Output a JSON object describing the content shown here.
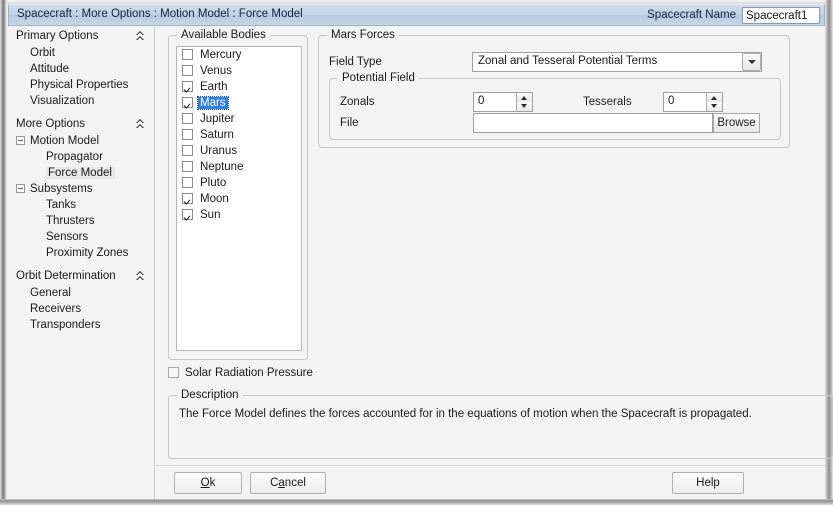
{
  "window": {
    "title": "Spacecraft : More Options : Motion Model : Force Model",
    "spacecraft_name_label": "Spacecraft Name",
    "spacecraft_name_value": "Spacecraft1",
    "accent_selection_color": "#2f7fe0",
    "titlebar_color": "#c2d2e6"
  },
  "tree": {
    "sections": [
      {
        "label": "Primary Options",
        "collapse_icon": "double-chevron-up-icon",
        "items": [
          {
            "label": "Orbit",
            "level": 1,
            "selected": false,
            "expander": false
          },
          {
            "label": "Attitude",
            "level": 1,
            "selected": false,
            "expander": false
          },
          {
            "label": "Physical Properties",
            "level": 1,
            "selected": false,
            "expander": false
          },
          {
            "label": "Visualization",
            "level": 1,
            "selected": false,
            "expander": false
          }
        ]
      },
      {
        "label": "More Options",
        "collapse_icon": "double-chevron-up-icon",
        "items": [
          {
            "label": "Motion Model",
            "level": 2,
            "selected": false,
            "expander": true
          },
          {
            "label": "Propagator",
            "level": 3,
            "selected": false,
            "expander": false
          },
          {
            "label": "Force Model",
            "level": 3,
            "selected": true,
            "expander": false
          },
          {
            "label": "Subsystems",
            "level": 2,
            "selected": false,
            "expander": true
          },
          {
            "label": "Tanks",
            "level": 3,
            "selected": false,
            "expander": false
          },
          {
            "label": "Thrusters",
            "level": 3,
            "selected": false,
            "expander": false
          },
          {
            "label": "Sensors",
            "level": 3,
            "selected": false,
            "expander": false
          },
          {
            "label": "Proximity Zones",
            "level": 3,
            "selected": false,
            "expander": false
          }
        ]
      },
      {
        "label": "Orbit Determination",
        "collapse_icon": "double-chevron-up-icon",
        "items": [
          {
            "label": "General",
            "level": 1,
            "selected": false,
            "expander": false
          },
          {
            "label": "Receivers",
            "level": 1,
            "selected": false,
            "expander": false
          },
          {
            "label": "Transponders",
            "level": 1,
            "selected": false,
            "expander": false
          }
        ]
      }
    ]
  },
  "available_bodies": {
    "group_title": "Available Bodies",
    "items": [
      {
        "label": "Mercury",
        "checked": false,
        "selected": false
      },
      {
        "label": "Venus",
        "checked": false,
        "selected": false
      },
      {
        "label": "Earth",
        "checked": true,
        "selected": false
      },
      {
        "label": "Mars",
        "checked": true,
        "selected": true
      },
      {
        "label": "Jupiter",
        "checked": false,
        "selected": false
      },
      {
        "label": "Saturn",
        "checked": false,
        "selected": false
      },
      {
        "label": "Uranus",
        "checked": false,
        "selected": false
      },
      {
        "label": "Neptune",
        "checked": false,
        "selected": false
      },
      {
        "label": "Pluto",
        "checked": false,
        "selected": false
      },
      {
        "label": "Moon",
        "checked": true,
        "selected": false
      },
      {
        "label": "Sun",
        "checked": true,
        "selected": false
      }
    ]
  },
  "solar_radiation_pressure": {
    "label": "Solar Radiation Pressure",
    "checked": false
  },
  "mars_forces": {
    "group_title": "Mars Forces",
    "field_type_label": "Field Type",
    "field_type_value": "Zonal and Tesseral Potential Terms",
    "dropdown_icon": "chevron-down-icon",
    "potential_field": {
      "group_title": "Potential Field",
      "zonals_label": "Zonals",
      "zonals_value": "0",
      "tesserals_label": "Tesserals",
      "tesserals_value": "0",
      "file_label": "File",
      "file_value": "",
      "browse_label": "Browse"
    }
  },
  "description": {
    "group_title": "Description",
    "text": "The Force Model defines the forces accounted for in the equations of motion when the Spacecraft is propagated."
  },
  "buttons": {
    "ok": "Ok",
    "ok_mnemonic": "O",
    "cancel": "Cancel",
    "cancel_mnemonic": "a",
    "help": "Help"
  }
}
